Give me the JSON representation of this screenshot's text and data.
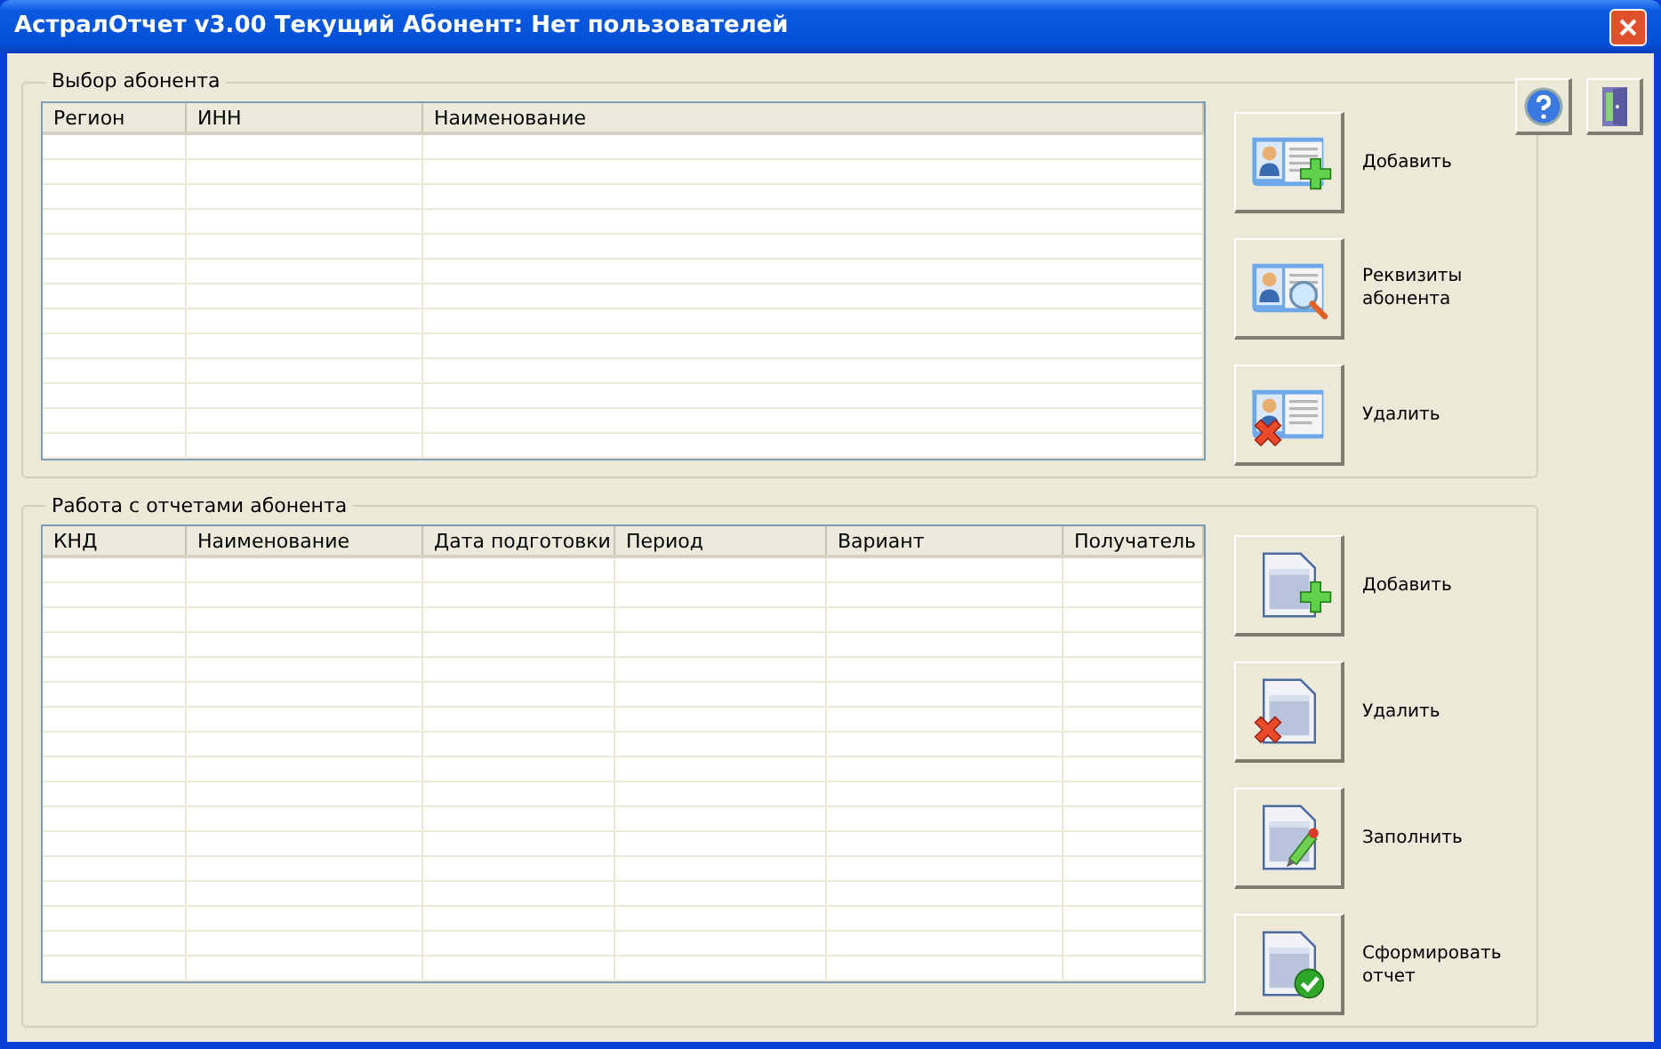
{
  "window": {
    "title": "АстралОтчет v3.00 Текущий Абонент: Нет пользователей"
  },
  "subscribers": {
    "title": "Выбор абонента",
    "columns": [
      "Регион",
      "ИНН",
      "Наименование"
    ],
    "buttons": [
      {
        "kind": "add",
        "label": "Добавить"
      },
      {
        "kind": "details",
        "label": "Реквизиты абонента"
      },
      {
        "kind": "delete",
        "label": "Удалить"
      }
    ]
  },
  "reports": {
    "title": "Работа с отчетами абонента",
    "columns": [
      "КНД",
      "Наименование",
      "Дата подготовки",
      "Период",
      "Вариант",
      "Получатель"
    ],
    "buttons": [
      {
        "kind": "add",
        "label": "Добавить"
      },
      {
        "kind": "delete",
        "label": "Удалить"
      },
      {
        "kind": "fill",
        "label": "Заполнить"
      },
      {
        "kind": "generate",
        "label": "Сформировать отчет"
      }
    ]
  }
}
